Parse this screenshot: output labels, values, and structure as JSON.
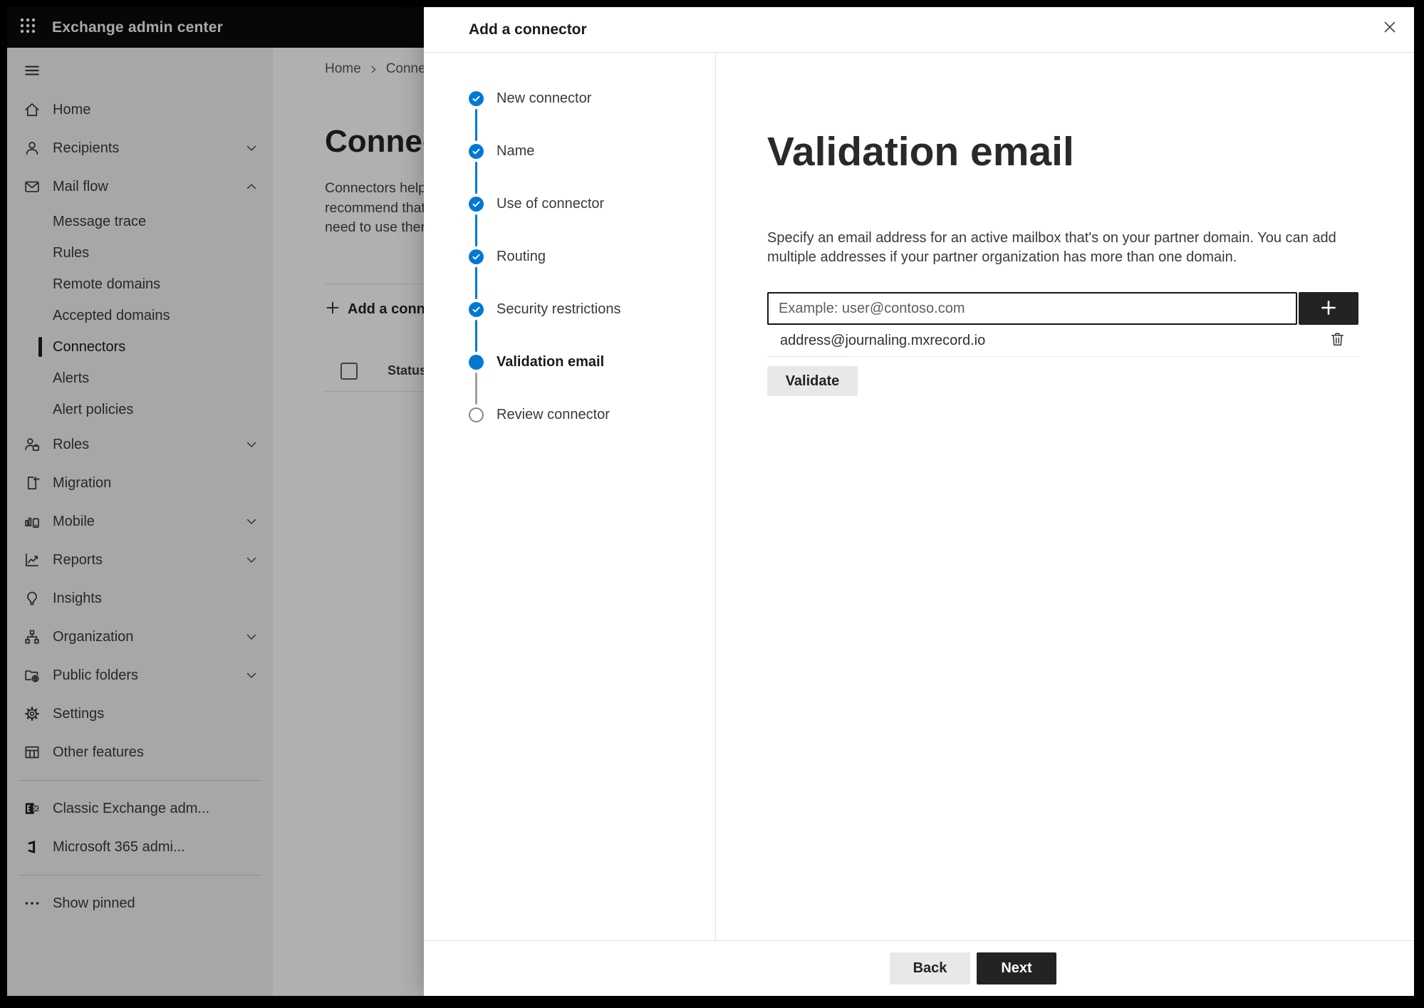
{
  "colors": {
    "accent": "#0078d4",
    "overlay": "rgba(0,0,0,0.31)",
    "primary_button": "#242322",
    "topbar_bg": "#0b0b0b",
    "sidebar_bg": "#f3f2f1"
  },
  "topbar": {
    "title": "Exchange admin center"
  },
  "sidebar": {
    "items": [
      {
        "type": "item",
        "icon": "home-icon",
        "label": "Home"
      },
      {
        "type": "item",
        "icon": "person-icon",
        "label": "Recipients",
        "chevron": "down"
      },
      {
        "type": "item",
        "icon": "mail-icon",
        "label": "Mail flow",
        "chevron": "up"
      },
      {
        "type": "subitem",
        "label": "Message trace"
      },
      {
        "type": "subitem",
        "label": "Rules"
      },
      {
        "type": "subitem",
        "label": "Remote domains"
      },
      {
        "type": "subitem",
        "label": "Accepted domains"
      },
      {
        "type": "subitem",
        "label": "Connectors",
        "selected": true
      },
      {
        "type": "subitem",
        "label": "Alerts"
      },
      {
        "type": "subitem",
        "label": "Alert policies"
      },
      {
        "type": "item",
        "icon": "roles-icon",
        "label": "Roles",
        "chevron": "down"
      },
      {
        "type": "item",
        "icon": "migration-icon",
        "label": "Migration"
      },
      {
        "type": "item",
        "icon": "mobile-icon",
        "label": "Mobile",
        "chevron": "down"
      },
      {
        "type": "item",
        "icon": "reports-icon",
        "label": "Reports",
        "chevron": "down"
      },
      {
        "type": "item",
        "icon": "insights-icon",
        "label": "Insights"
      },
      {
        "type": "item",
        "icon": "organization-icon",
        "label": "Organization",
        "chevron": "down"
      },
      {
        "type": "item",
        "icon": "public-folders-icon",
        "label": "Public folders",
        "chevron": "down"
      },
      {
        "type": "item",
        "icon": "settings-icon",
        "label": "Settings"
      },
      {
        "type": "item",
        "icon": "other-features-icon",
        "label": "Other features"
      },
      {
        "type": "divider"
      },
      {
        "type": "item",
        "icon": "classic-exchange-icon",
        "label": "Classic Exchange adm..."
      },
      {
        "type": "item",
        "icon": "microsoft-365-icon",
        "label": "Microsoft 365 admi..."
      },
      {
        "type": "divider"
      },
      {
        "type": "item",
        "icon": "ellipsis-icon",
        "label": "Show pinned"
      }
    ]
  },
  "page": {
    "breadcrumb": [
      "Home",
      "Conne"
    ],
    "title": "Connec",
    "description_lines": [
      "Connectors help",
      "recommend that",
      "need to use ther"
    ],
    "add_button": "Add a conn",
    "table": {
      "status_header": "Status"
    }
  },
  "wizard": {
    "title": "Add a connector",
    "steps": [
      {
        "label": "New connector",
        "state": "done"
      },
      {
        "label": "Name",
        "state": "done"
      },
      {
        "label": "Use of connector",
        "state": "done"
      },
      {
        "label": "Routing",
        "state": "done"
      },
      {
        "label": "Security restrictions",
        "state": "done"
      },
      {
        "label": "Validation email",
        "state": "current"
      },
      {
        "label": "Review connector",
        "state": "todo"
      }
    ],
    "content": {
      "heading": "Validation email",
      "description": "Specify an email address for an active mailbox that's on your partner domain. You can add multiple addresses if your partner organization has more than one domain.",
      "email_input": {
        "value": "",
        "placeholder": "Example: user@contoso.com"
      },
      "added_addresses": [
        "address@journaling.mxrecord.io"
      ],
      "validate_button": "Validate"
    },
    "footer": {
      "back": "Back",
      "next": "Next"
    }
  }
}
